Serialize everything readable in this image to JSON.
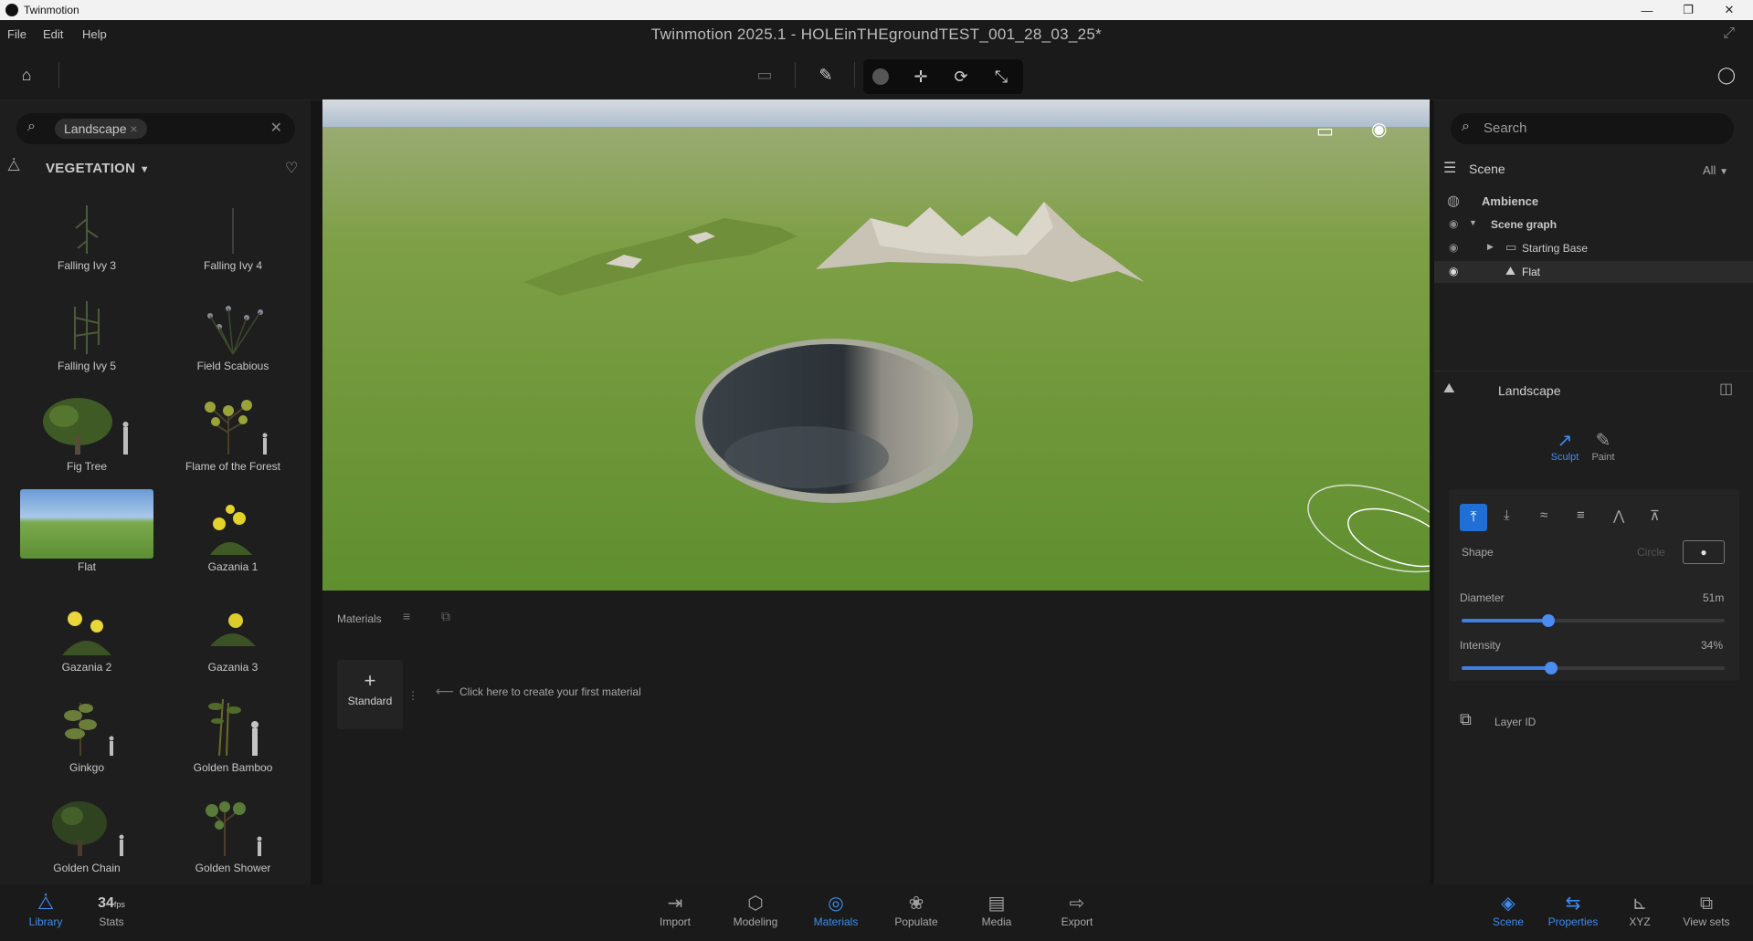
{
  "os_window": {
    "title": "Twinmotion",
    "controls": [
      "—",
      "❐",
      "✕"
    ]
  },
  "menu": {
    "items": [
      "File",
      "Edit",
      "Help"
    ]
  },
  "document_title": "Twinmotion 2025.1 - HOLEinTHEgroundTEST_001_28_03_25*",
  "left_panel": {
    "search_chip": "Landscape",
    "category": "VEGETATION",
    "assets": [
      {
        "label": "Falling Ivy 3"
      },
      {
        "label": "Falling Ivy 4"
      },
      {
        "label": "Falling Ivy 5"
      },
      {
        "label": "Field Scabious"
      },
      {
        "label": "Fig Tree"
      },
      {
        "label": "Flame of the Forest"
      },
      {
        "label": "Flat"
      },
      {
        "label": "Gazania 1"
      },
      {
        "label": "Gazania 2"
      },
      {
        "label": "Gazania 3"
      },
      {
        "label": "Ginkgo"
      },
      {
        "label": "Golden Bamboo"
      },
      {
        "label": "Golden Chain"
      },
      {
        "label": "Golden Shower"
      }
    ]
  },
  "materials": {
    "tab_label": "Materials",
    "standard_label": "Standard",
    "hint": "Click here to create your first material"
  },
  "right_panel": {
    "search_placeholder": "Search",
    "scene_title": "Scene",
    "filter": "All",
    "tree": {
      "ambience": "Ambience",
      "scene_graph": "Scene graph",
      "starting_base": "Starting Base",
      "flat": "Flat"
    },
    "landscape": {
      "title": "Landscape",
      "modes": {
        "sculpt": "Sculpt",
        "paint": "Paint"
      },
      "shape_label": "Shape",
      "shape_value": "Circle",
      "diameter_label": "Diameter",
      "diameter_value": "51m",
      "diameter_fraction": 0.33,
      "intensity_label": "Intensity",
      "intensity_value": "34%",
      "intensity_fraction": 0.34,
      "layer_label": "Layer ID"
    }
  },
  "bottom_bar": {
    "library": "Library",
    "stats_value": "34",
    "stats_unit": "fps",
    "stats_label": "Stats",
    "center": [
      "Import",
      "Modeling",
      "Materials",
      "Populate",
      "Media",
      "Export"
    ],
    "right": [
      "Scene",
      "Properties",
      "XYZ",
      "View sets"
    ]
  },
  "colors": {
    "accent": "#3f8cf0",
    "panel": "#1e1e1e"
  }
}
